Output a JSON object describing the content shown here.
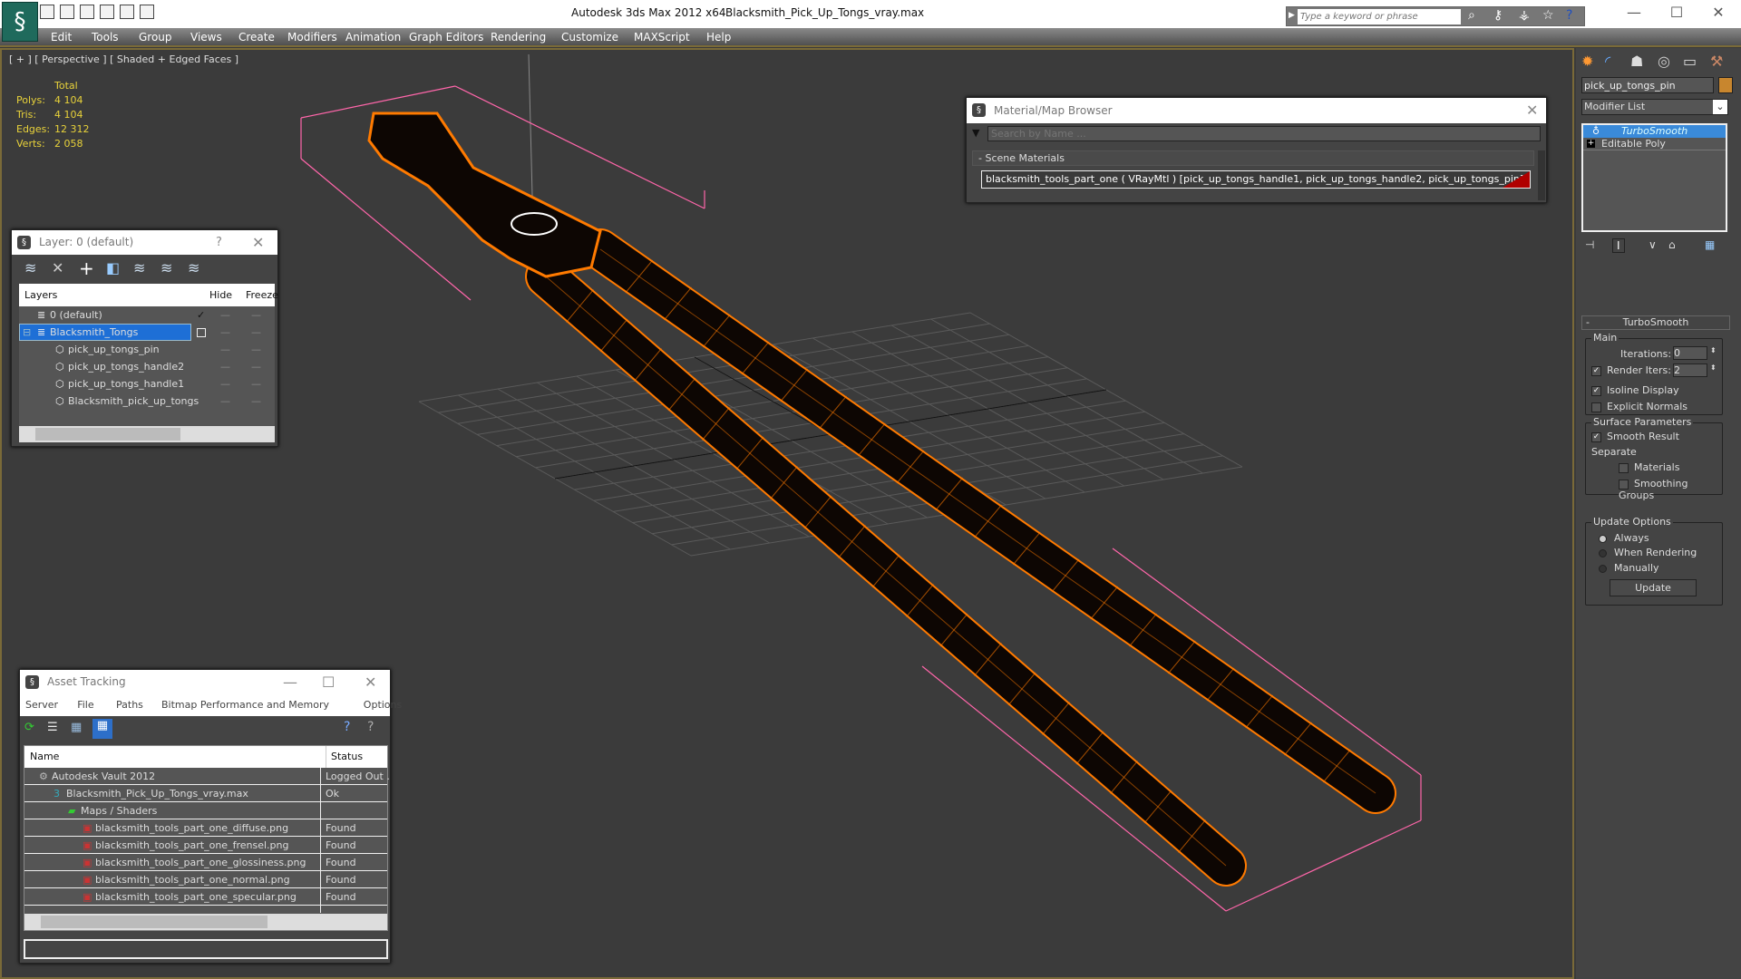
{
  "app": {
    "title": "Autodesk 3ds Max  2012 x64",
    "file": "Blacksmith_Pick_Up_Tongs_vray.max",
    "search_placeholder": "Type a keyword or phrase"
  },
  "menu": [
    "Edit",
    "Tools",
    "Group",
    "Views",
    "Create",
    "Modifiers",
    "Animation",
    "Graph Editors",
    "Rendering",
    "Customize",
    "MAXScript",
    "Help"
  ],
  "viewport": {
    "label": "[ + ] [ Perspective ] [ Shaded + Edged Faces ]",
    "stats": {
      "header": "Total",
      "rows": [
        {
          "label": "Polys:",
          "value": "4 104"
        },
        {
          "label": "Tris:",
          "value": "4 104"
        },
        {
          "label": "Edges:",
          "value": "12 312"
        },
        {
          "label": "Verts:",
          "value": "2 058"
        }
      ]
    },
    "colors": {
      "wire": "#ff7a00",
      "bbox": "#ff66aa",
      "grid": "#5a5a5a"
    }
  },
  "layer_dialog": {
    "title": "Layer: 0 (default)",
    "help": "?",
    "columns": [
      "Layers",
      "",
      "Hide",
      "Freeze"
    ],
    "rows": [
      {
        "name": "0 (default)",
        "active": "✓",
        "level": 0
      },
      {
        "name": "Blacksmith_Tongs",
        "level": 0,
        "selected": true
      },
      {
        "name": "pick_up_tongs_pin",
        "level": 1
      },
      {
        "name": "pick_up_tongs_handle2",
        "level": 1
      },
      {
        "name": "pick_up_tongs_handle1",
        "level": 1
      },
      {
        "name": "Blacksmith_pick_up_tongs",
        "level": 1
      }
    ]
  },
  "material_browser": {
    "title": "Material/Map Browser",
    "search_placeholder": "Search by Name ...",
    "section": "Scene Materials",
    "material": "blacksmith_tools_part_one ( VRayMtl ) [pick_up_tongs_handle1, pick_up_tongs_handle2, pick_up_tongs_pin]",
    "swatch_color": "#b00000"
  },
  "asset_tracking": {
    "title": "Asset Tracking",
    "menu": [
      "Server",
      "File",
      "Paths",
      "Bitmap Performance and Memory",
      "Options"
    ],
    "columns": [
      "Name",
      "Status"
    ],
    "rows": [
      {
        "name": "Autodesk Vault 2012",
        "status": "Logged Out .",
        "level": 1,
        "icon": "vault-icon"
      },
      {
        "name": "Blacksmith_Pick_Up_Tongs_vray.max",
        "status": "Ok",
        "level": 2,
        "icon": "max-file-icon"
      },
      {
        "name": "Maps / Shaders",
        "status": "",
        "level": 3,
        "icon": "maps-icon"
      },
      {
        "name": "blacksmith_tools_part_one_diffuse.png",
        "status": "Found",
        "level": 4,
        "icon": "png-icon"
      },
      {
        "name": "blacksmith_tools_part_one_frensel.png",
        "status": "Found",
        "level": 4,
        "icon": "png-icon"
      },
      {
        "name": "blacksmith_tools_part_one_glossiness.png",
        "status": "Found",
        "level": 4,
        "icon": "png-icon"
      },
      {
        "name": "blacksmith_tools_part_one_normal.png",
        "status": "Found",
        "level": 4,
        "icon": "png-icon"
      },
      {
        "name": "blacksmith_tools_part_one_specular.png",
        "status": "Found",
        "level": 4,
        "icon": "png-icon"
      }
    ]
  },
  "command_panel": {
    "object_name": "pick_up_tongs_pin",
    "object_color": "#c8862e",
    "modifier_list": "Modifier List",
    "stack": [
      "TurboSmooth",
      "Editable Poly"
    ],
    "rollout": "TurboSmooth",
    "main": "Main",
    "iterations_label": "Iterations:",
    "iterations": "0",
    "render_iters_label": "Render Iters:",
    "render_iters": "2",
    "isoline": "Isoline Display",
    "explicit": "Explicit Normals",
    "surface": "Surface Parameters",
    "smooth_result": "Smooth Result",
    "separate": "Separate",
    "materials": "Materials",
    "smoothing_groups": "Smoothing Groups",
    "update_options": "Update Options",
    "always": "Always",
    "when_rendering": "When Rendering",
    "manually": "Manually",
    "update": "Update"
  }
}
